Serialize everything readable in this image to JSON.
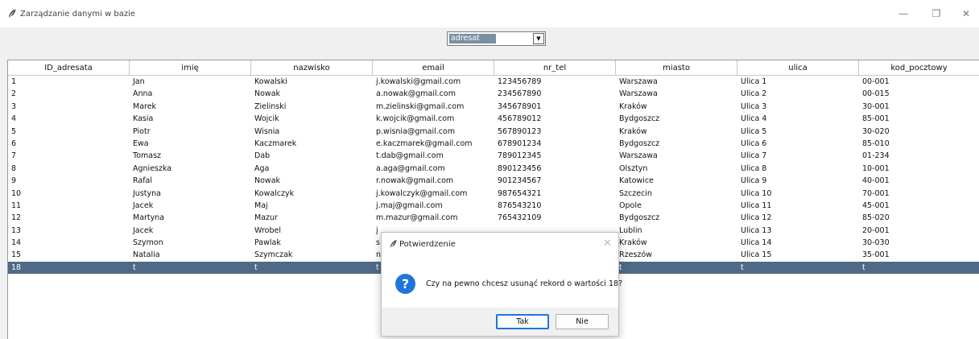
{
  "window": {
    "title": "Zarządzanie danymi w bazie",
    "minimize": "—",
    "maximize": "❐",
    "close": "✕"
  },
  "combo": {
    "selected": "adresat",
    "arrow": "▼"
  },
  "table": {
    "columns": [
      "ID_adresata",
      "imię",
      "nazwisko",
      "email",
      "nr_tel",
      "miasto",
      "ulica",
      "kod_pocztowy"
    ],
    "rows": [
      [
        "1",
        "Jan",
        "Kowalski",
        "j.kowalski@gmail.com",
        "123456789",
        "Warszawa",
        "Ulica 1",
        "00-001"
      ],
      [
        "2",
        "Anna",
        "Nowak",
        "a.nowak@gmail.com",
        "234567890",
        "Warszawa",
        "Ulica 2",
        "00-015"
      ],
      [
        "3",
        "Marek",
        "Zielinski",
        "m.zielinski@gmail.com",
        "345678901",
        "Kraków",
        "Ulica 3",
        "30-001"
      ],
      [
        "4",
        "Kasia",
        "Wojcik",
        "k.wojcik@gmail.com",
        "456789012",
        "Bydgoszcz",
        "Ulica 4",
        "85-001"
      ],
      [
        "5",
        "Piotr",
        "Wisnia",
        "p.wisnia@gmail.com",
        "567890123",
        "Kraków",
        "Ulica 5",
        "30-020"
      ],
      [
        "6",
        "Ewa",
        "Kaczmarek",
        "e.kaczmarek@gmail.com",
        "678901234",
        "Bydgoszcz",
        "Ulica 6",
        "85-010"
      ],
      [
        "7",
        "Tomasz",
        "Dab",
        "t.dab@gmail.com",
        "789012345",
        "Warszawa",
        "Ulica 7",
        "01-234"
      ],
      [
        "8",
        "Agnieszka",
        "Aga",
        "a.aga@gmail.com",
        "890123456",
        "Olsztyn",
        "Ulica 8",
        "10-001"
      ],
      [
        "9",
        "Rafal",
        "Nowak",
        "r.nowak@gmail.com",
        "901234567",
        "Katowice",
        "Ulica 9",
        "40-001"
      ],
      [
        "10",
        "Justyna",
        "Kowalczyk",
        "j.kowalczyk@gmail.com",
        "987654321",
        "Szczecin",
        "Ulica 10",
        "70-001"
      ],
      [
        "11",
        "Jacek",
        "Maj",
        "j.maj@gmail.com",
        "876543210",
        "Opole",
        "Ulica 11",
        "45-001"
      ],
      [
        "12",
        "Martyna",
        "Mazur",
        "m.mazur@gmail.com",
        "765432109",
        "Bydgoszcz",
        "Ulica 12",
        "85-020"
      ],
      [
        "13",
        "Jacek",
        "Wrobel",
        "j",
        "",
        "Lublin",
        "Ulica 13",
        "20-001"
      ],
      [
        "14",
        "Szymon",
        "Pawlak",
        "s",
        "",
        "Kraków",
        "Ulica 14",
        "30-030"
      ],
      [
        "15",
        "Natalia",
        "Szymczak",
        "n",
        "",
        "Rzeszów",
        "Ulica 15",
        "35-001"
      ],
      [
        "18",
        "t",
        "t",
        "t",
        "",
        "t",
        "t",
        "t"
      ]
    ],
    "selected_row_index": 15
  },
  "dialog": {
    "title": "Potwierdzenie",
    "close": "✕",
    "icon": "?",
    "message": "Czy na pewno chcesz usunąć rekord o wartości 18?",
    "yes_label": "Tak",
    "no_label": "Nie"
  },
  "colors": {
    "selection": "#4e6a86",
    "accent": "#1e76d8"
  }
}
